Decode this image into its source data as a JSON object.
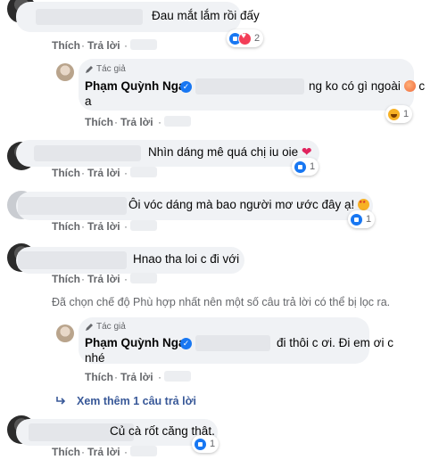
{
  "actions": {
    "like": "Thích",
    "reply": "Trả lời",
    "sep": "·"
  },
  "author_tag": "Tác giả",
  "author_name": "Phạm Quỳnh Nga",
  "comments": [
    {
      "text": "Đau mắt lắm rồi đấy",
      "reactions": [
        "like",
        "love"
      ],
      "reaction_count": "2"
    },
    {
      "text_a": "ng ko có gì ngoài",
      "text_b": "c",
      "text_c": "a",
      "reactions": [
        "haha"
      ],
      "reaction_count": "1"
    },
    {
      "text": "Nhìn dáng mê quá chị iu oie",
      "reactions": [
        "like"
      ],
      "reaction_count": "1"
    },
    {
      "text": "Ôi vóc dáng mà bao người mơ ước đây ạ!",
      "reactions": [
        "like"
      ],
      "reaction_count": "1"
    },
    {
      "text": "Hnao tha loi c đi với"
    },
    {
      "text_a": "đi thôi c ơi. Đi em ơi c",
      "text_b": "nhé"
    },
    {
      "text": "Củ cà rốt căng thật.",
      "reactions": [
        "like"
      ],
      "reaction_count": "1"
    }
  ],
  "filter_notice": "Đã chọn chế độ Phù hợp nhất nên một số câu trả lời có thể bị lọc ra.",
  "see_more": "Xem thêm 1 câu trả lời",
  "icons": {
    "like": "like-icon",
    "love": "love-icon",
    "haha": "haha-icon",
    "verified": "verified-icon",
    "pen": "pen-icon",
    "reply-arrow": "reply-arrow-icon"
  },
  "colors": {
    "link": "#385898",
    "meta": "#65676b",
    "bubble": "#f0f2f5",
    "accent": "#1877f2"
  }
}
